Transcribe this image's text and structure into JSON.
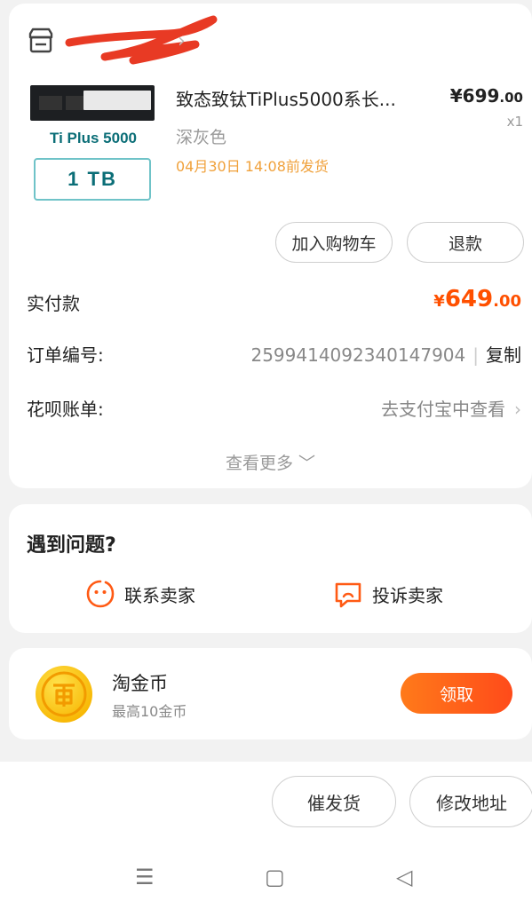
{
  "order": {
    "product": {
      "title": "致态致钛TiPlus5000系长...",
      "brand_text": "Ti Plus 5000",
      "capacity_text": "1 TB",
      "price_main": "¥699",
      "price_decimal": ".00",
      "quantity": "x1",
      "variant": "深灰色",
      "ship_note": "04月30日 14:08前发货"
    },
    "buttons": {
      "add_cart": "加入购物车",
      "refund": "退款"
    },
    "paid": {
      "label": "实付款",
      "currency": "¥",
      "amount_main": "649",
      "amount_decimal": ".00"
    },
    "order_number": {
      "label": "订单编号:",
      "value": "2599414092340147904",
      "separator": "|",
      "copy_label": "复制"
    },
    "huabei": {
      "label": "花呗账单:",
      "value": "去支付宝中查看",
      "chevron": "›"
    },
    "more": "查看更多 ﹀"
  },
  "problems": {
    "title": "遇到问题?",
    "contact": "联系卖家",
    "complain": "投诉卖家"
  },
  "coins": {
    "title": "淘金币",
    "subtitle": "最高10金币",
    "claim": "领取"
  },
  "bottom": {
    "urge": "催发货",
    "edit_address": "修改地址"
  },
  "nav": {
    "menu": "☰",
    "home": "▢",
    "back": "◁"
  },
  "colors": {
    "accent": "#ff5000",
    "ship_note": "#f0a13b"
  }
}
